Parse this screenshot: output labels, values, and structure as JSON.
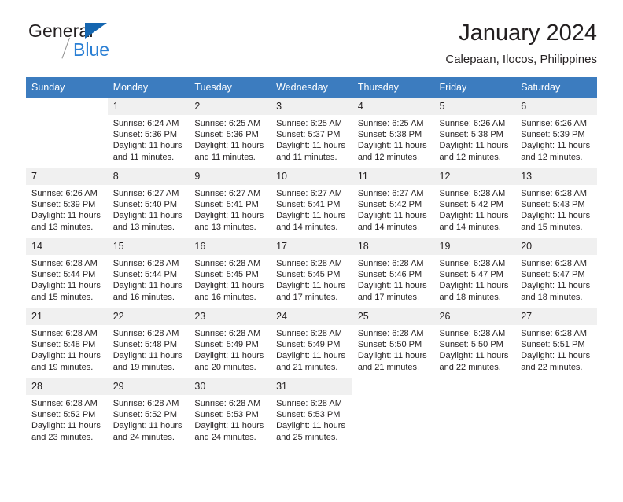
{
  "brand": {
    "name_part1": "General",
    "name_part2": "Blue",
    "triangle_color": "#1566b0",
    "blue_color": "#2a7fd4"
  },
  "header": {
    "title": "January 2024",
    "subtitle": "Calepaan, Ilocos, Philippines"
  },
  "theme": {
    "header_bg": "#3c7cbf",
    "header_text": "#ffffff",
    "daynum_bg": "#f0f0f0",
    "grid_line": "#b9c6d4"
  },
  "weekdays": [
    "Sunday",
    "Monday",
    "Tuesday",
    "Wednesday",
    "Thursday",
    "Friday",
    "Saturday"
  ],
  "weeks": [
    [
      {
        "day": "",
        "sunrise": "",
        "sunset": "",
        "daylight1": "",
        "daylight2": ""
      },
      {
        "day": "1",
        "sunrise": "Sunrise: 6:24 AM",
        "sunset": "Sunset: 5:36 PM",
        "daylight1": "Daylight: 11 hours",
        "daylight2": "and 11 minutes."
      },
      {
        "day": "2",
        "sunrise": "Sunrise: 6:25 AM",
        "sunset": "Sunset: 5:36 PM",
        "daylight1": "Daylight: 11 hours",
        "daylight2": "and 11 minutes."
      },
      {
        "day": "3",
        "sunrise": "Sunrise: 6:25 AM",
        "sunset": "Sunset: 5:37 PM",
        "daylight1": "Daylight: 11 hours",
        "daylight2": "and 11 minutes."
      },
      {
        "day": "4",
        "sunrise": "Sunrise: 6:25 AM",
        "sunset": "Sunset: 5:38 PM",
        "daylight1": "Daylight: 11 hours",
        "daylight2": "and 12 minutes."
      },
      {
        "day": "5",
        "sunrise": "Sunrise: 6:26 AM",
        "sunset": "Sunset: 5:38 PM",
        "daylight1": "Daylight: 11 hours",
        "daylight2": "and 12 minutes."
      },
      {
        "day": "6",
        "sunrise": "Sunrise: 6:26 AM",
        "sunset": "Sunset: 5:39 PM",
        "daylight1": "Daylight: 11 hours",
        "daylight2": "and 12 minutes."
      }
    ],
    [
      {
        "day": "7",
        "sunrise": "Sunrise: 6:26 AM",
        "sunset": "Sunset: 5:39 PM",
        "daylight1": "Daylight: 11 hours",
        "daylight2": "and 13 minutes."
      },
      {
        "day": "8",
        "sunrise": "Sunrise: 6:27 AM",
        "sunset": "Sunset: 5:40 PM",
        "daylight1": "Daylight: 11 hours",
        "daylight2": "and 13 minutes."
      },
      {
        "day": "9",
        "sunrise": "Sunrise: 6:27 AM",
        "sunset": "Sunset: 5:41 PM",
        "daylight1": "Daylight: 11 hours",
        "daylight2": "and 13 minutes."
      },
      {
        "day": "10",
        "sunrise": "Sunrise: 6:27 AM",
        "sunset": "Sunset: 5:41 PM",
        "daylight1": "Daylight: 11 hours",
        "daylight2": "and 14 minutes."
      },
      {
        "day": "11",
        "sunrise": "Sunrise: 6:27 AM",
        "sunset": "Sunset: 5:42 PM",
        "daylight1": "Daylight: 11 hours",
        "daylight2": "and 14 minutes."
      },
      {
        "day": "12",
        "sunrise": "Sunrise: 6:28 AM",
        "sunset": "Sunset: 5:42 PM",
        "daylight1": "Daylight: 11 hours",
        "daylight2": "and 14 minutes."
      },
      {
        "day": "13",
        "sunrise": "Sunrise: 6:28 AM",
        "sunset": "Sunset: 5:43 PM",
        "daylight1": "Daylight: 11 hours",
        "daylight2": "and 15 minutes."
      }
    ],
    [
      {
        "day": "14",
        "sunrise": "Sunrise: 6:28 AM",
        "sunset": "Sunset: 5:44 PM",
        "daylight1": "Daylight: 11 hours",
        "daylight2": "and 15 minutes."
      },
      {
        "day": "15",
        "sunrise": "Sunrise: 6:28 AM",
        "sunset": "Sunset: 5:44 PM",
        "daylight1": "Daylight: 11 hours",
        "daylight2": "and 16 minutes."
      },
      {
        "day": "16",
        "sunrise": "Sunrise: 6:28 AM",
        "sunset": "Sunset: 5:45 PM",
        "daylight1": "Daylight: 11 hours",
        "daylight2": "and 16 minutes."
      },
      {
        "day": "17",
        "sunrise": "Sunrise: 6:28 AM",
        "sunset": "Sunset: 5:45 PM",
        "daylight1": "Daylight: 11 hours",
        "daylight2": "and 17 minutes."
      },
      {
        "day": "18",
        "sunrise": "Sunrise: 6:28 AM",
        "sunset": "Sunset: 5:46 PM",
        "daylight1": "Daylight: 11 hours",
        "daylight2": "and 17 minutes."
      },
      {
        "day": "19",
        "sunrise": "Sunrise: 6:28 AM",
        "sunset": "Sunset: 5:47 PM",
        "daylight1": "Daylight: 11 hours",
        "daylight2": "and 18 minutes."
      },
      {
        "day": "20",
        "sunrise": "Sunrise: 6:28 AM",
        "sunset": "Sunset: 5:47 PM",
        "daylight1": "Daylight: 11 hours",
        "daylight2": "and 18 minutes."
      }
    ],
    [
      {
        "day": "21",
        "sunrise": "Sunrise: 6:28 AM",
        "sunset": "Sunset: 5:48 PM",
        "daylight1": "Daylight: 11 hours",
        "daylight2": "and 19 minutes."
      },
      {
        "day": "22",
        "sunrise": "Sunrise: 6:28 AM",
        "sunset": "Sunset: 5:48 PM",
        "daylight1": "Daylight: 11 hours",
        "daylight2": "and 19 minutes."
      },
      {
        "day": "23",
        "sunrise": "Sunrise: 6:28 AM",
        "sunset": "Sunset: 5:49 PM",
        "daylight1": "Daylight: 11 hours",
        "daylight2": "and 20 minutes."
      },
      {
        "day": "24",
        "sunrise": "Sunrise: 6:28 AM",
        "sunset": "Sunset: 5:49 PM",
        "daylight1": "Daylight: 11 hours",
        "daylight2": "and 21 minutes."
      },
      {
        "day": "25",
        "sunrise": "Sunrise: 6:28 AM",
        "sunset": "Sunset: 5:50 PM",
        "daylight1": "Daylight: 11 hours",
        "daylight2": "and 21 minutes."
      },
      {
        "day": "26",
        "sunrise": "Sunrise: 6:28 AM",
        "sunset": "Sunset: 5:50 PM",
        "daylight1": "Daylight: 11 hours",
        "daylight2": "and 22 minutes."
      },
      {
        "day": "27",
        "sunrise": "Sunrise: 6:28 AM",
        "sunset": "Sunset: 5:51 PM",
        "daylight1": "Daylight: 11 hours",
        "daylight2": "and 22 minutes."
      }
    ],
    [
      {
        "day": "28",
        "sunrise": "Sunrise: 6:28 AM",
        "sunset": "Sunset: 5:52 PM",
        "daylight1": "Daylight: 11 hours",
        "daylight2": "and 23 minutes."
      },
      {
        "day": "29",
        "sunrise": "Sunrise: 6:28 AM",
        "sunset": "Sunset: 5:52 PM",
        "daylight1": "Daylight: 11 hours",
        "daylight2": "and 24 minutes."
      },
      {
        "day": "30",
        "sunrise": "Sunrise: 6:28 AM",
        "sunset": "Sunset: 5:53 PM",
        "daylight1": "Daylight: 11 hours",
        "daylight2": "and 24 minutes."
      },
      {
        "day": "31",
        "sunrise": "Sunrise: 6:28 AM",
        "sunset": "Sunset: 5:53 PM",
        "daylight1": "Daylight: 11 hours",
        "daylight2": "and 25 minutes."
      },
      {
        "day": "",
        "sunrise": "",
        "sunset": "",
        "daylight1": "",
        "daylight2": ""
      },
      {
        "day": "",
        "sunrise": "",
        "sunset": "",
        "daylight1": "",
        "daylight2": ""
      },
      {
        "day": "",
        "sunrise": "",
        "sunset": "",
        "daylight1": "",
        "daylight2": ""
      }
    ]
  ]
}
